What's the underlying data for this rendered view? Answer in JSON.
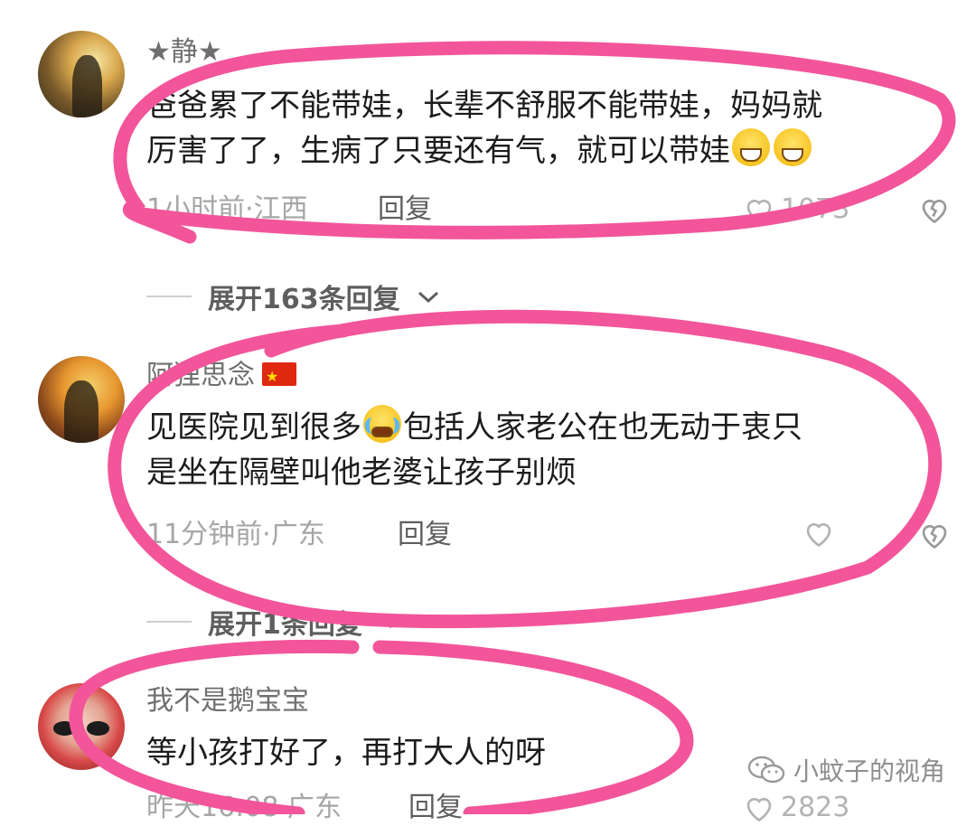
{
  "comments": [
    {
      "username": "★静★",
      "content_line1": "爸爸累了不能带娃，长辈不舒服不能带娃，妈妈就",
      "content_line2": "厉害了了，生病了只要还有气，就可以带娃",
      "meta": "1小时前·江西",
      "reply_label": "回复",
      "likes": "1073"
    },
    {
      "username": "阿狸思念",
      "content_line1_a": "见医院见到很多",
      "content_line1_b": "包括人家老公在也无动于衷只",
      "content_line2": "是坐在隔壁叫他老婆让孩子别烦",
      "meta": "11分钟前·广东",
      "reply_label": "回复",
      "likes": ""
    },
    {
      "username": "我不是鹅宝宝",
      "content_line1": "等小孩打好了，再打大人的呀",
      "meta": "昨天16:08·广东",
      "reply_label": "回复",
      "likes": "2823"
    }
  ],
  "expand_replies": [
    {
      "label": "展开163条回复"
    },
    {
      "label": "展开1条回复"
    }
  ],
  "watermark": {
    "text": "小蚊子的视角"
  },
  "colors": {
    "marker": "#f2559a",
    "text": "#1c1c1c",
    "meta": "#a6a6a6"
  },
  "icons": [
    "heart-icon",
    "broken-heart-icon",
    "chevron-down-icon",
    "grin-emoji-icon",
    "crying-laughing-emoji-icon",
    "china-flag-icon",
    "wechat-icon"
  ]
}
